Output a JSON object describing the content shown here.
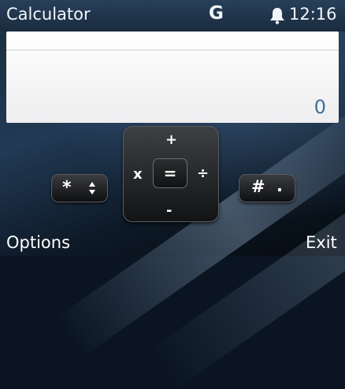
{
  "status_bar": {
    "app_title": "Calculator",
    "network": "G",
    "alert_icon": "bell-icon",
    "time": "12:16"
  },
  "display": {
    "value": "0"
  },
  "keys": {
    "star": "*",
    "hash": "#",
    "hash_sub": ".",
    "plus": "+",
    "minus": "-",
    "times": "x",
    "divide": "÷",
    "equals": "="
  },
  "softkeys": {
    "left": "Options",
    "right": "Exit"
  },
  "colors": {
    "display_digit": "#3e6f9a",
    "status_bar": "#1a2b3e"
  }
}
